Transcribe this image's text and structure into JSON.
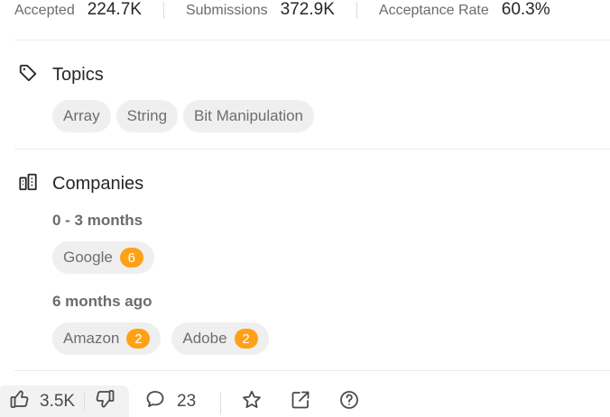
{
  "stats": [
    {
      "label": "Accepted",
      "value": "224.7K"
    },
    {
      "label": "Submissions",
      "value": "372.9K"
    },
    {
      "label": "Acceptance Rate",
      "value": "60.3%"
    }
  ],
  "topics": {
    "title": "Topics",
    "icon": "tag-icon",
    "tags": [
      "Array",
      "String",
      "Bit Manipulation"
    ]
  },
  "companies": {
    "title": "Companies",
    "icon": "building-icon",
    "groups": [
      {
        "period": "0 - 3 months",
        "items": [
          {
            "name": "Google",
            "count": "6"
          }
        ]
      },
      {
        "period": "6 months ago",
        "items": [
          {
            "name": "Amazon",
            "count": "2"
          },
          {
            "name": "Adobe",
            "count": "2"
          }
        ]
      }
    ]
  },
  "actions": {
    "likes": "3.5K",
    "comments": "23",
    "icons": [
      "thumbs-up-icon",
      "thumbs-down-icon",
      "comment-icon",
      "star-icon",
      "share-icon",
      "help-icon"
    ]
  },
  "colors": {
    "badge": "#ffa116",
    "chip_bg": "#efefef",
    "divider": "#ececec"
  }
}
